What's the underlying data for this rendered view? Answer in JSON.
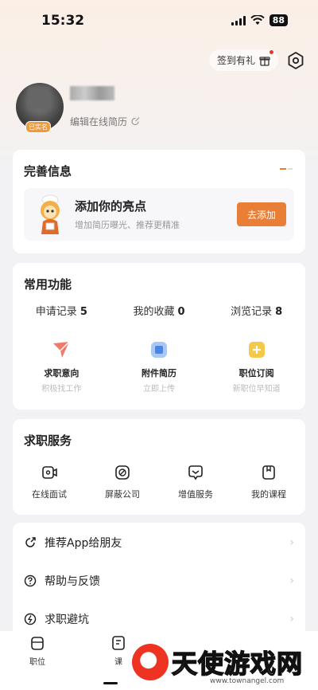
{
  "status_bar": {
    "time": "15:32",
    "battery": "88"
  },
  "top_actions": {
    "signin_label": "签到有礼"
  },
  "profile": {
    "avatar_badge": "已实名",
    "edit_resume": "编辑在线简历"
  },
  "complete_info": {
    "title": "完善信息",
    "highlight_title": "添加你的亮点",
    "highlight_sub": "增加简历曝光、推荐更精准",
    "add_button": "去添加"
  },
  "common_features": {
    "title": "常用功能",
    "stats": [
      {
        "label": "申请记录",
        "value": "5"
      },
      {
        "label": "我的收藏",
        "value": "0"
      },
      {
        "label": "浏览记录",
        "value": "8"
      }
    ],
    "features": [
      {
        "label": "求职意向",
        "sub": "积极找工作",
        "icon": "send-icon"
      },
      {
        "label": "附件简历",
        "sub": "立即上传",
        "icon": "attachment-icon"
      },
      {
        "label": "职位订阅",
        "sub": "新职位早知道",
        "icon": "subscribe-icon"
      }
    ]
  },
  "job_services": {
    "title": "求职服务",
    "items": [
      {
        "label": "在线面试",
        "icon": "video-icon"
      },
      {
        "label": "屏蔽公司",
        "icon": "block-icon"
      },
      {
        "label": "增值服务",
        "icon": "value-icon"
      },
      {
        "label": "我的课程",
        "icon": "course-icon"
      }
    ]
  },
  "menu_list": [
    {
      "label": "推荐App给朋友",
      "icon": "share-icon"
    },
    {
      "label": "帮助与反馈",
      "icon": "help-icon"
    },
    {
      "label": "求职避坑",
      "icon": "warning-icon"
    }
  ],
  "tabbar": [
    {
      "label": "职位",
      "icon": "jobs-icon"
    },
    {
      "label": "课",
      "icon": "course-tab-icon"
    }
  ],
  "watermark": {
    "text": "天使游戏网",
    "url": "www.townangel.com"
  },
  "colors": {
    "accent": "#e97f36",
    "background": "#f2f2f4"
  }
}
